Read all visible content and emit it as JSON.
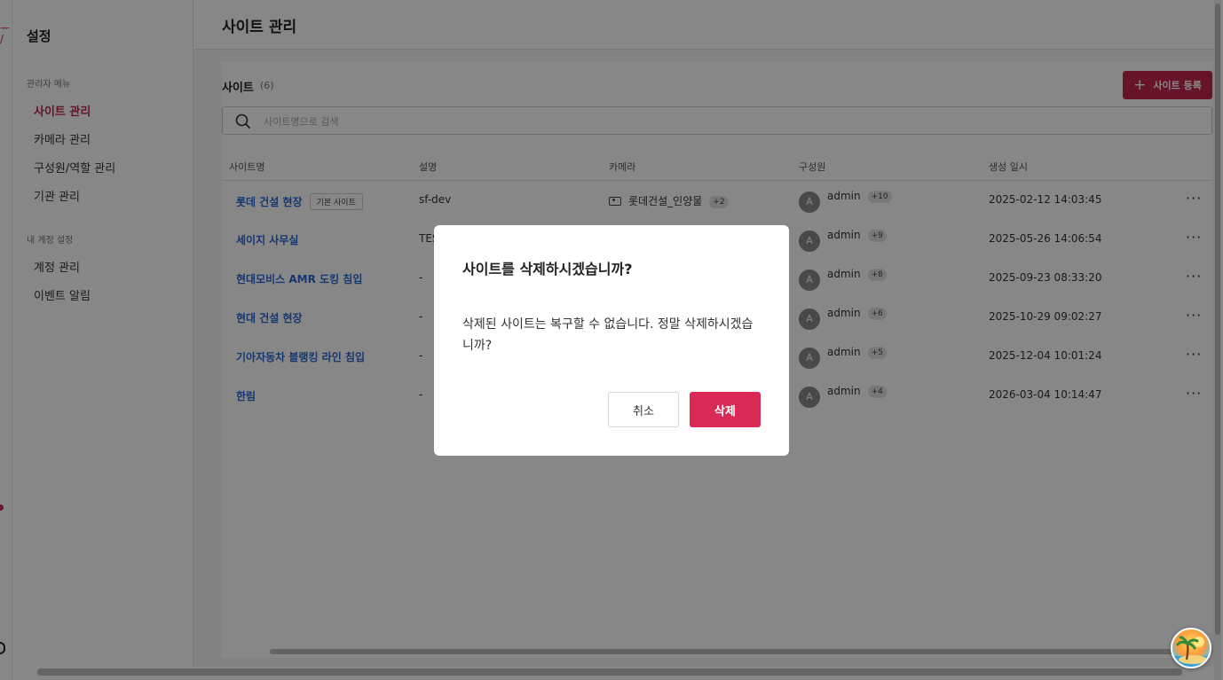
{
  "rail": {
    "top_glyph": "ᅲ",
    "top_glyph2": "/"
  },
  "sidebar": {
    "title": "설정",
    "admin_section": "관리자 메뉴",
    "admin_items": [
      {
        "label": "사이트 관리",
        "active": true
      },
      {
        "label": "카메라 관리"
      },
      {
        "label": "구성원/역할 관리"
      },
      {
        "label": "기관 관리"
      }
    ],
    "account_section": "내 계정 설정",
    "account_items": [
      {
        "label": "계정 관리"
      },
      {
        "label": "이벤트 알림"
      }
    ]
  },
  "page": {
    "title": "사이트 관리"
  },
  "card": {
    "title": "사이트",
    "count": "(6)",
    "add_button": "사이트 등록",
    "search_placeholder": "사이트명으로 검색"
  },
  "table": {
    "columns": [
      "사이트명",
      "설명",
      "카메라",
      "구성원",
      "생성 일시"
    ],
    "rows": [
      {
        "name": "롯데 건설 현장",
        "tag": "기본 사이트",
        "desc": "sf-dev",
        "camera": "롯데건설_인양물",
        "camera_more": "+2",
        "avatar": "A",
        "member": "admin",
        "member_more": "+10",
        "created": "2025-02-12 14:03:45"
      },
      {
        "name": "세이지 사무실",
        "desc": "TES",
        "avatar": "A",
        "member": "admin",
        "member_more": "+9",
        "created": "2025-05-26 14:06:54"
      },
      {
        "name": "현대모비스 AMR 도킹 침입",
        "desc": "-",
        "avatar": "A",
        "member": "admin",
        "member_more": "+8",
        "created": "2025-09-23 08:33:20"
      },
      {
        "name": "현대 건설 현장",
        "desc": "-",
        "avatar": "A",
        "member": "admin",
        "member_more": "+6",
        "created": "2025-10-29 09:02:27"
      },
      {
        "name": "기아자동차 블랭킹 라인 침입",
        "desc": "-",
        "avatar": "A",
        "member": "admin",
        "member_more": "+5",
        "created": "2025-12-04 10:01:24"
      },
      {
        "name": "한림",
        "desc": "-",
        "avatar": "A",
        "member": "admin",
        "member_more": "+4",
        "created": "2026-03-04 10:14:47"
      }
    ],
    "more_glyph": "···"
  },
  "modal": {
    "title": "사이트를 삭제하시겠습니까?",
    "body": "삭제된 사이트는 복구할 수 없습니다. 정말 삭제하시겠습니까?",
    "cancel": "취소",
    "confirm": "삭제"
  },
  "colors": {
    "accent": "#c3264f",
    "danger": "#d92a55",
    "link": "#2a6ad3"
  }
}
